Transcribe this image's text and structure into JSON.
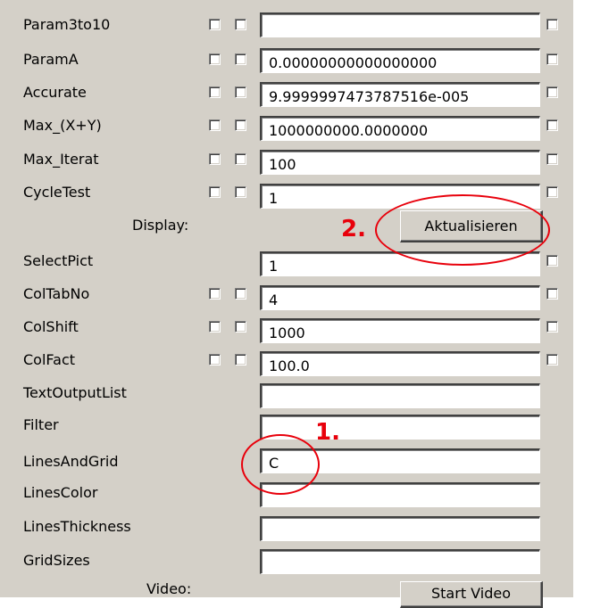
{
  "rows": [
    {
      "label": "Param3to10",
      "value": ""
    },
    {
      "label": "ParamA",
      "value": "0.00000000000000000"
    },
    {
      "label": "Accurate",
      "value": "9.9999997473787516e-005"
    },
    {
      "label": "Max_(X+Y)",
      "value": "1000000000.0000000"
    },
    {
      "label": "Max_Iterat",
      "value": "100"
    },
    {
      "label": "CycleTest",
      "value": "1"
    }
  ],
  "display": {
    "label": "Display:",
    "button_label": "Aktualisieren"
  },
  "rows2": [
    {
      "label": "SelectPict",
      "value": "1"
    },
    {
      "label": "ColTabNo",
      "value": "4"
    },
    {
      "label": "ColShift",
      "value": "1000"
    },
    {
      "label": "ColFact",
      "value": "100.0"
    },
    {
      "label": "TextOutputList",
      "value": ""
    },
    {
      "label": "Filter",
      "value": ""
    },
    {
      "label": "LinesAndGrid",
      "value": "C"
    },
    {
      "label": "LinesColor",
      "value": ""
    },
    {
      "label": "LinesThickness",
      "value": ""
    },
    {
      "label": "GridSizes",
      "value": ""
    }
  ],
  "video": {
    "label": "Video:",
    "button_label": "Start Video"
  },
  "annotations": {
    "step1": "1.",
    "step2": "2.",
    "color": "#e8000b"
  }
}
